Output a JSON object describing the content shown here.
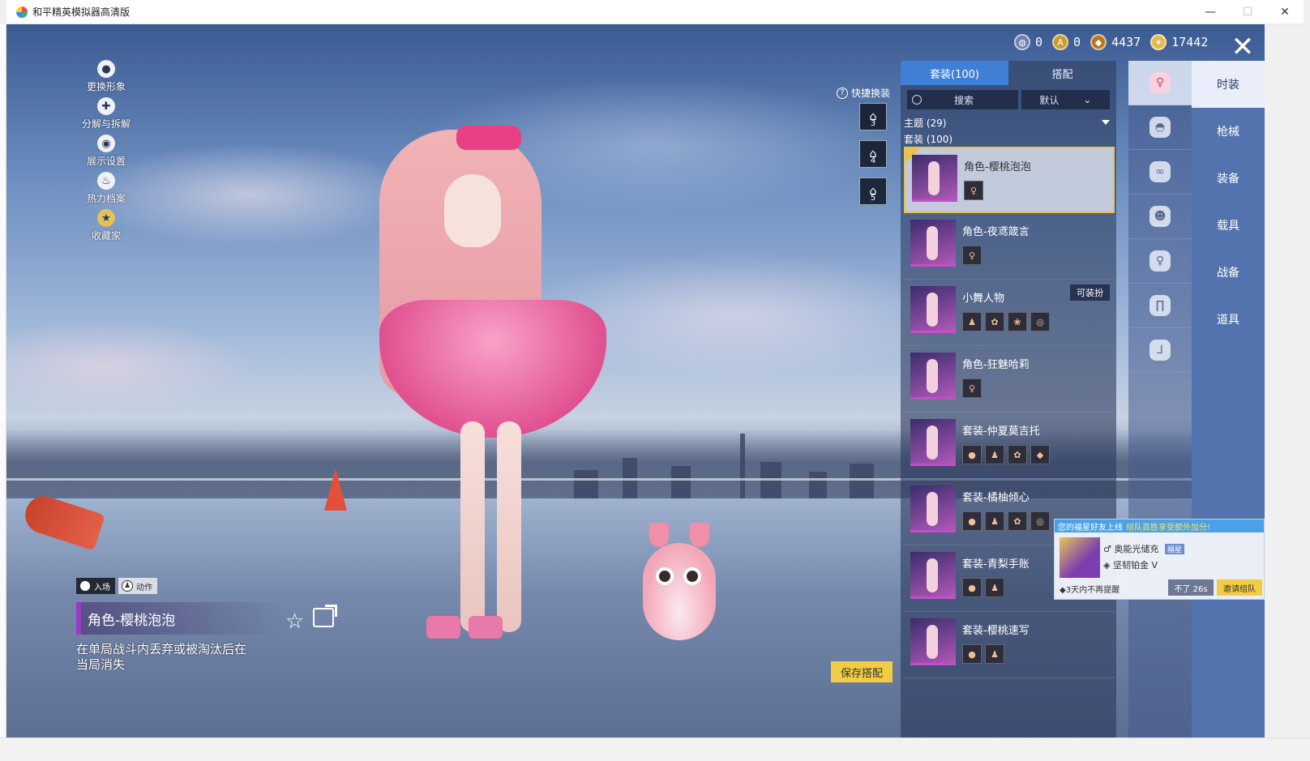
{
  "window": {
    "title": "和平精英模拟器高清版",
    "minimize": "—",
    "maximize": "☐",
    "close": "✕"
  },
  "left_menu": [
    {
      "label": "更换形象",
      "icon": "avatar-change-icon"
    },
    {
      "label": "分解与拆解",
      "icon": "puzzle-icon"
    },
    {
      "label": "展示设置",
      "icon": "eye-icon"
    },
    {
      "label": "热力档案",
      "icon": "fire-icon"
    },
    {
      "label": "收藏家",
      "icon": "collector-badge-icon"
    }
  ],
  "currency": [
    {
      "value": "0",
      "icon": "globe-coin-icon",
      "color": "#6b7fb0"
    },
    {
      "value": "0",
      "icon": "gold-medal-icon",
      "color": "#c99a2e"
    },
    {
      "value": "4437",
      "icon": "bronze-coin-icon",
      "color": "#b8741f"
    },
    {
      "value": "17442",
      "icon": "gold-coin-icon",
      "color": "#e6b84a"
    }
  ],
  "quick_change": {
    "label": "快捷换装",
    "slots": [
      "3",
      "4",
      "5"
    ]
  },
  "outfit_panel": {
    "tabs": [
      "套装(100)",
      "搭配"
    ],
    "search_placeholder": "搜索",
    "sort_value": "默认",
    "filter_label": "主题 (29)",
    "subheading": "套装 (100)",
    "items": [
      {
        "name": "角色-樱桃泡泡",
        "subs": [
          "♀"
        ],
        "selected": true
      },
      {
        "name": "角色-夜鸢箴言",
        "subs": [
          "♀"
        ]
      },
      {
        "name": "小舞人物",
        "subs": [
          "♟",
          "✿",
          "❀",
          "◎"
        ],
        "tag": "可装扮"
      },
      {
        "name": "角色-狂魅哈莉",
        "subs": [
          "♀"
        ]
      },
      {
        "name": "套装-仲夏莫吉托",
        "subs": [
          "●",
          "♟",
          "✿",
          "◆"
        ]
      },
      {
        "name": "套装-橘柚倾心",
        "subs": [
          "●",
          "♟",
          "✿",
          "◎"
        ]
      },
      {
        "name": "套装-青梨手账",
        "subs": [
          "●",
          "♟"
        ]
      },
      {
        "name": "套装-樱桃速写",
        "subs": [
          "●",
          "♟"
        ]
      }
    ]
  },
  "categories": [
    {
      "icon": "outfit-icon",
      "active": true
    },
    {
      "icon": "hat-icon"
    },
    {
      "icon": "glasses-icon"
    },
    {
      "icon": "mask-icon"
    },
    {
      "icon": "top-icon"
    },
    {
      "icon": "pants-icon"
    },
    {
      "icon": "shoes-icon"
    }
  ],
  "main_tabs": [
    "时装",
    "枪械",
    "装备",
    "载具",
    "战备",
    "道具"
  ],
  "character_info": {
    "entry_label": "入场",
    "action_label": "动作",
    "name": "角色-樱桃泡泡",
    "description": "在单局战斗内丢弃或被淘汰后在当局消失"
  },
  "save_button": "保存搭配",
  "notification": {
    "header": "您的福星好友上线",
    "header_highlight": "组队首胜享受额外加分!",
    "friend_name": "奥能光储充",
    "friend_badge": "福星",
    "rank": "坚韧铂金 V",
    "remind_label": "3天内不再提醒",
    "decline_label": "不了 26s",
    "invite_label": "邀请组队"
  }
}
